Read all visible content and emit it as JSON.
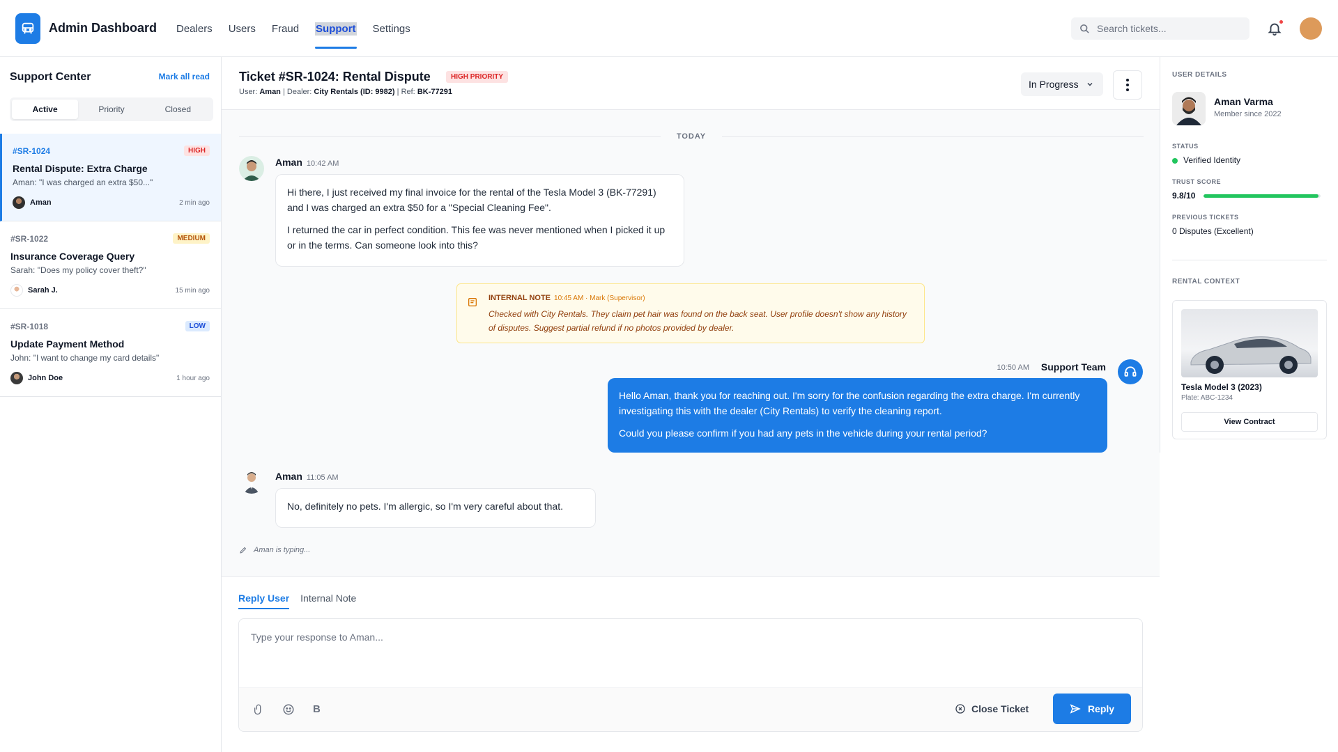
{
  "header": {
    "app_title": "Admin Dashboard",
    "nav": [
      "Dealers",
      "Users",
      "Fraud",
      "Support",
      "Settings"
    ],
    "active_nav": "Support",
    "search_placeholder": "Search tickets..."
  },
  "sidebar": {
    "title": "Support Center",
    "mark_all_read": "Mark all read",
    "tabs": [
      "Active",
      "Priority",
      "Closed"
    ],
    "active_tab": "Active",
    "tickets": [
      {
        "id": "#SR-1024",
        "priority": "HIGH",
        "subject": "Rental Dispute: Extra Charge",
        "preview": "Aman: \"I was charged an extra $50...\"",
        "user": "Aman",
        "time": "2 min ago"
      },
      {
        "id": "#SR-1022",
        "priority": "MEDIUM",
        "subject": "Insurance Coverage Query",
        "preview": "Sarah: \"Does my policy cover theft?\"",
        "user": "Sarah J.",
        "time": "15 min ago"
      },
      {
        "id": "#SR-1018",
        "priority": "LOW",
        "subject": "Update Payment Method",
        "preview": "John: \"I want to change my card details\"",
        "user": "John Doe",
        "time": "1 hour ago"
      }
    ]
  },
  "ticket": {
    "title": "Ticket #SR-1024: Rental Dispute",
    "priority_badge": "HIGH PRIORITY",
    "meta": {
      "user_label": "User:",
      "user": "Aman",
      "dealer_label": "Dealer:",
      "dealer": "City Rentals (ID: 9982)",
      "ref_label": "Ref:",
      "ref": "BK-77291"
    },
    "status": "In Progress",
    "day_divider": "TODAY"
  },
  "messages": {
    "m1": {
      "author": "Aman",
      "time": "10:42 AM",
      "p1": "Hi there, I just received my final invoice for the rental of the Tesla Model 3 (BK-77291) and I was charged an extra $50 for a \"Special Cleaning Fee\".",
      "p2": "I returned the car in perfect condition. This fee was never mentioned when I picked it up or in the terms. Can someone look into this?"
    },
    "note": {
      "label": "INTERNAL NOTE",
      "meta": "10:45 AM · Mark (Supervisor)",
      "text": "Checked with City Rentals. They claim pet hair was found on the back seat. User profile doesn't show any history of disputes. Suggest partial refund if no photos provided by dealer."
    },
    "m2": {
      "author": "Support Team",
      "time": "10:50 AM",
      "p1": "Hello Aman, thank you for reaching out. I'm sorry for the confusion regarding the extra charge. I'm currently investigating this with the dealer (City Rentals) to verify the cleaning report.",
      "p2": "Could you please confirm if you had any pets in the vehicle during your rental period?"
    },
    "m3": {
      "author": "Aman",
      "time": "11:05 AM",
      "p1": "No, definitely no pets. I'm allergic, so I'm very careful about that."
    },
    "typing": "Aman is typing..."
  },
  "composer": {
    "tabs": [
      "Reply User",
      "Internal Note"
    ],
    "active_tab": "Reply User",
    "placeholder": "Type your response to Aman...",
    "bold_label": "B",
    "close_label": "Close Ticket",
    "reply_label": "Reply"
  },
  "user_details": {
    "section_label": "USER DETAILS",
    "name": "Aman Varma",
    "since": "Member since 2022",
    "status_label": "STATUS",
    "status": "Verified Identity",
    "trust_label": "TRUST SCORE",
    "trust": "9.8/10",
    "trust_fraction": 0.98,
    "prev_label": "PREVIOUS TICKETS",
    "prev": "0 Disputes (Excellent)"
  },
  "rental": {
    "section_label": "RENTAL CONTEXT",
    "car": "Tesla Model 3 (2023)",
    "plate": "Plate: ABC-1234",
    "view_label": "View Contract"
  },
  "colors": {
    "accent": "#1d7ce5",
    "high": "#dc2626",
    "medium": "#b45309",
    "low": "#1d4ed8",
    "verified": "#22c55e"
  }
}
